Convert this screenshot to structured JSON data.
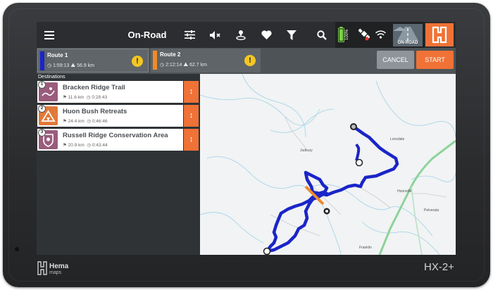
{
  "topbar": {
    "menu_icon": "hamburger-menu-icon",
    "title": "On-Road",
    "icons": [
      "sliders-icon",
      "mute-icon",
      "location-pin-icon",
      "heart-icon",
      "filter-icon",
      "search-icon"
    ],
    "battery_percent": "100%",
    "onroad_label": "ON-ROAD",
    "hema_logo": "hema-logo-icon"
  },
  "routes": {
    "items": [
      {
        "name": "Route 1",
        "time": "1:59:13",
        "distance": "56.9 km",
        "color": "#1a25c8"
      },
      {
        "name": "Route 2",
        "time": "2:12:14",
        "distance": "62.7 km",
        "color": "#f08a2a"
      }
    ],
    "cancel_label": "CANCEL",
    "start_label": "START"
  },
  "destinations": {
    "header": "Destinations",
    "items": [
      {
        "num": "1",
        "name": "Bracken Ridge Trail",
        "distance": "11.6 km",
        "time": "0:28:43",
        "icon": "trail-icon"
      },
      {
        "num": "2",
        "name": "Huon Bush Retreats",
        "distance": "24.4 km",
        "time": "0:46:46",
        "icon": "campsite-icon"
      },
      {
        "num": "3",
        "name": "Russell Ridge Conservation Area",
        "distance": "20.9 km",
        "time": "0:43:44",
        "icon": "conservation-area-icon"
      }
    ]
  },
  "map": {
    "place_labels": [
      "Lonsdale",
      "Hoonville",
      "Pelverata",
      "Franklin",
      "Judbury"
    ],
    "route_color": "#1a25c8",
    "alt_route_color": "#f08a2a"
  },
  "device": {
    "brand_name": "Hema",
    "brand_sub": "maps",
    "model": "HX-2+"
  },
  "colors": {
    "accent": "#f07236",
    "topbar": "#2b2d30"
  }
}
